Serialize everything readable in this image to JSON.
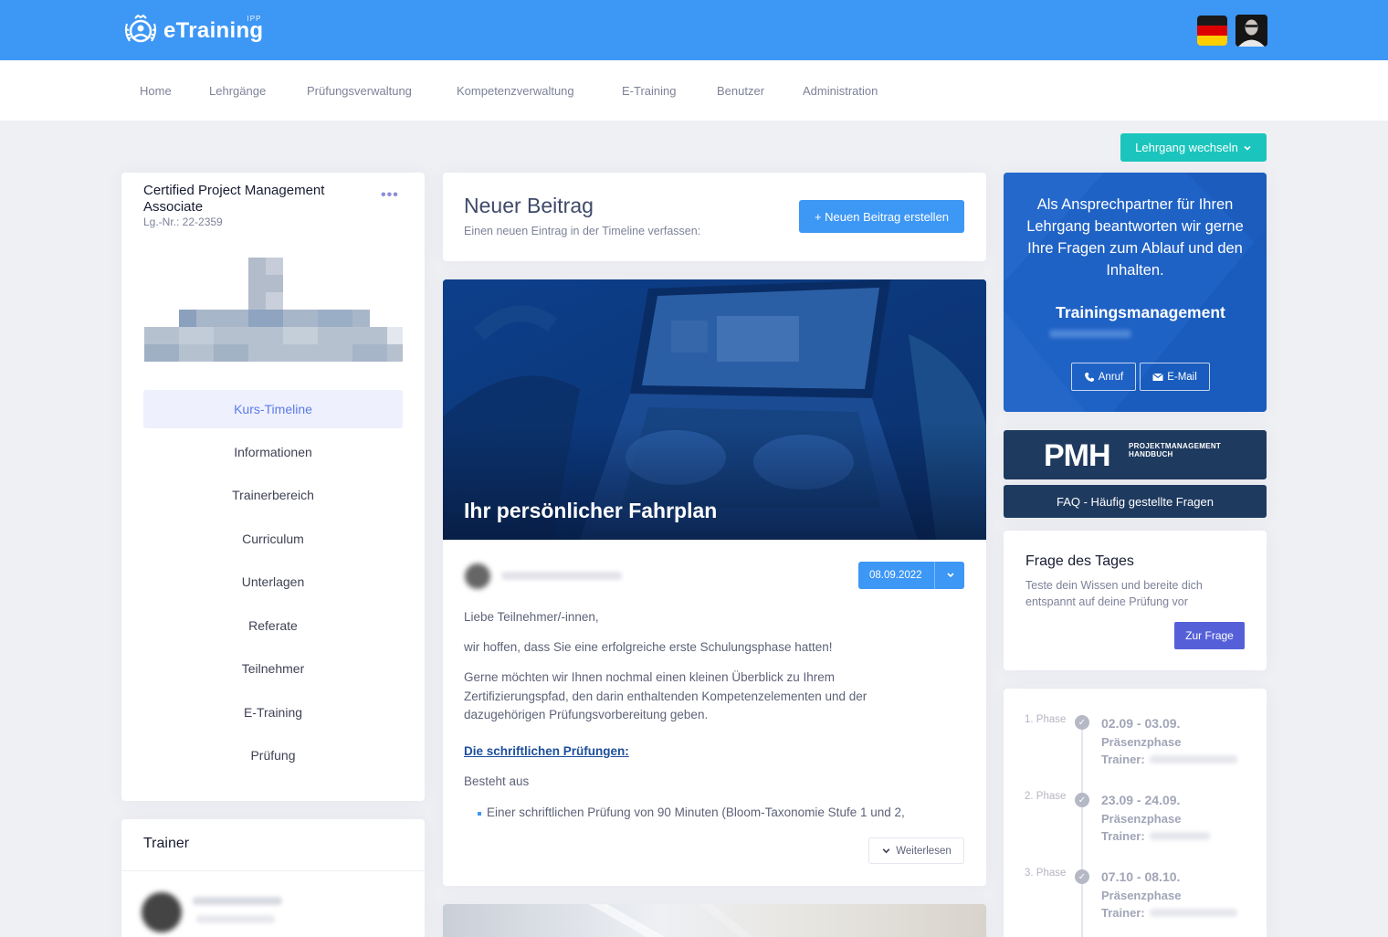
{
  "header": {
    "logo_text": "eTraining",
    "logo_sup": "IPP",
    "flag_colors": [
      "#1a1a1a",
      "#dd0000",
      "#ffce00"
    ]
  },
  "nav": {
    "items": [
      "Home",
      "Lehrgänge",
      "Prüfungsverwaltung",
      "Kompetenzverwaltung",
      "E-Training",
      "Benutzer",
      "Administration"
    ]
  },
  "switch_course": {
    "label": "Lehrgang wechseln",
    "chevron_icon": "chevron-down-icon"
  },
  "course": {
    "title": "Certified Project Management Associate",
    "number": "Lg.-Nr.: 22-2359",
    "menu_icon": "more-horizontal-icon",
    "menu": [
      "Kurs-Timeline",
      "Informationen",
      "Trainerbereich",
      "Curriculum",
      "Unterlagen",
      "Referate",
      "Teilnehmer",
      "E-Training",
      "Prüfung"
    ],
    "active_index": 0
  },
  "trainer": {
    "title": "Trainer"
  },
  "new_post": {
    "title": "Neuer Beitrag",
    "subtitle": "Einen neuen Eintrag in der Timeline verfassen:",
    "button": "+ Neuen Beitrag erstellen"
  },
  "post": {
    "hero_title": "Ihr persönlicher Fahrplan",
    "date": "08.09.2022",
    "paragraphs": [
      "Liebe Teilnehmer/-innen,",
      "wir hoffen, dass Sie eine erfolgreiche erste Schulungsphase hatten!",
      "Gerne möchten wir Ihnen nochmal einen kleinen Überblick zu Ihrem Zertifizierungspfad, den darin enthaltenden Kompetenzelementen und der dazugehörigen Prüfungsvorbereitung geben."
    ],
    "section_link": "Die schriftlichen Prüfungen:",
    "consists": "Besteht aus",
    "bullet": "Einer schriftlichen Prüfung von 90 Minuten (Bloom-Taxonomie Stufe 1 und 2,",
    "read_more": "Weiterlesen"
  },
  "contact": {
    "text": "Als Ansprechpartner für Ihren Lehrgang beantworten wir gerne Ihre Fragen zum Ablauf und den Inhalten.",
    "role": "Trainingsmanagement",
    "call": "Anruf",
    "email": "E-Mail",
    "call_icon": "phone-icon",
    "email_icon": "envelope-icon"
  },
  "pmh": {
    "big": "PMH",
    "small_line1": "PROJEKTMANAGEMENT",
    "small_line2": "HANDBUCH"
  },
  "faq": {
    "label": "FAQ - Häufig gestellte Fragen"
  },
  "quiz": {
    "title": "Frage des Tages",
    "subtitle": "Teste dein Wissen und bereite dich entspannt auf deine Prüfung vor",
    "button": "Zur Frage"
  },
  "phases": [
    {
      "label": "1. Phase",
      "dates": "02.09 - 03.09.",
      "type": "Präsenzphase",
      "trainer_label": "Trainer:"
    },
    {
      "label": "2. Phase",
      "dates": "23.09 - 24.09.",
      "type": "Präsenzphase",
      "trainer_label": "Trainer:"
    },
    {
      "label": "3. Phase",
      "dates": "07.10 - 08.10.",
      "type": "Präsenzphase",
      "trainer_label": "Trainer:"
    }
  ],
  "colors": {
    "primary": "#3d97f5",
    "teal": "#1bc5bd",
    "indigo": "#5560d8",
    "navy": "#1f3a5f",
    "contact_blue": "#1f62c5"
  }
}
